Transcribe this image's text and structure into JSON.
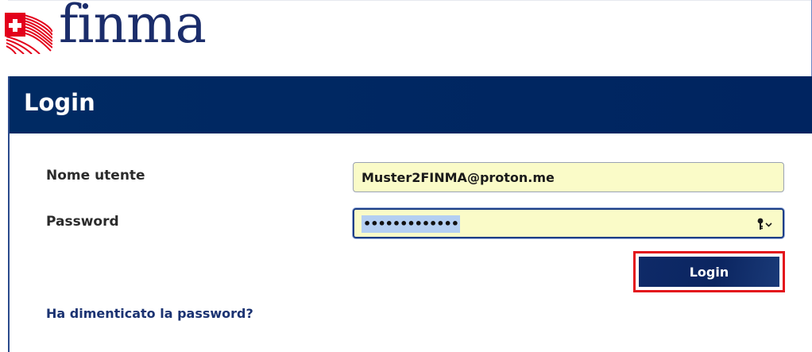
{
  "brand": {
    "logo_text": "finma",
    "logo_icon": "swiss-cross-flag-icon"
  },
  "login": {
    "title": "Login",
    "username_label": "Nome utente",
    "username_value": "Muster2FINMA@proton.me",
    "password_label": "Password",
    "password_masked": "•••••••••••••",
    "password_icon": "key-icon",
    "submit_label": "Login",
    "forgot_link": "Ha dimenticato la password?"
  },
  "colors": {
    "brand_navy": "#002460",
    "autofill_yellow": "#fafbc8",
    "highlight_red": "#e3141c",
    "link_blue": "#1b3372",
    "logo_red": "#e3001b"
  }
}
